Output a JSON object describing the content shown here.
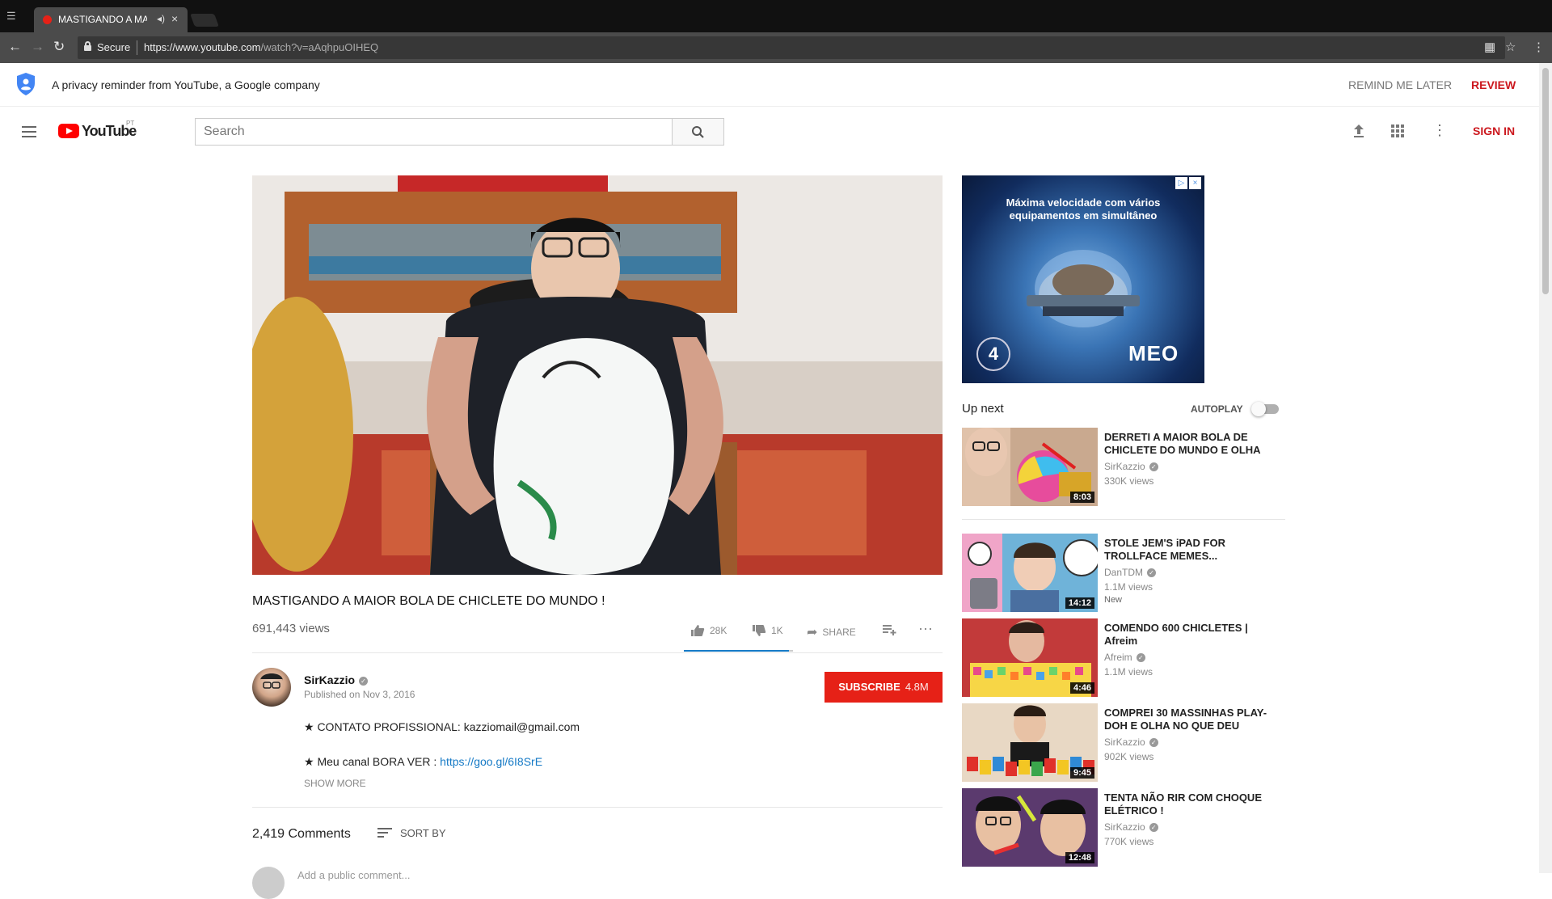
{
  "browser": {
    "tab_title": "MASTIGANDO A MAI",
    "secure_label": "Secure",
    "url_host": "https://www.youtube.com",
    "url_path": "/watch?v=aAqhpuOIHEQ"
  },
  "privacy": {
    "message": "A privacy reminder from YouTube, a Google company",
    "remind_label": "REMIND ME LATER",
    "review_label": "REVIEW"
  },
  "masthead": {
    "logo_text": "YouTube",
    "region": "PT",
    "search_placeholder": "Search",
    "signin_label": "SIGN IN"
  },
  "icons": {
    "menu": "hamburger-icon",
    "search": "search-icon",
    "upload": "upload-icon",
    "apps": "apps-grid-icon",
    "more": "more-vertical-icon"
  },
  "ad": {
    "headline": "Máxima velocidade com vários equipamentos em simultâneo",
    "brand": "MEO",
    "badge_number": "4"
  },
  "video": {
    "title": "MASTIGANDO A MAIOR BOLA DE CHICLETE DO MUNDO !",
    "views": "691,443 views",
    "likes": "28K",
    "dislikes": "1K",
    "share_label": "SHARE",
    "like_ratio": 0.966
  },
  "owner": {
    "name": "SirKazzio",
    "published": "Published on Nov 3, 2016",
    "subscribe_label": "SUBSCRIBE",
    "subscriber_count": "4.8M"
  },
  "description": {
    "line1": "★ CONTATO PROFISSIONAL: kazziomail@gmail.com",
    "line2_prefix": "★ Meu canal BORA VER : ",
    "line2_link": "https://goo.gl/6I8SrE",
    "show_more": "SHOW MORE"
  },
  "comments": {
    "count": "2,419 Comments",
    "sort_label": "SORT BY",
    "placeholder": "Add a public comment..."
  },
  "sidebar": {
    "up_next": "Up next",
    "autoplay_label": "AUTOPLAY",
    "autoplay_on": false,
    "items": [
      {
        "title": "DERRETI A MAIOR BOLA DE CHICLETE DO MUNDO E OLHA",
        "channel": "SirKazzio",
        "views": "330K views",
        "duration": "8:03",
        "badge": ""
      },
      {
        "title": "STOLE JEM'S iPAD FOR TROLLFACE MEMES...",
        "channel": "DanTDM",
        "views": "1.1M views",
        "duration": "14:12",
        "badge": "New"
      },
      {
        "title": "COMENDO 600 CHICLETES | Afreim",
        "channel": "Afreim",
        "views": "1.1M views",
        "duration": "4:46",
        "badge": ""
      },
      {
        "title": "COMPREI 30 MASSINHAS PLAY-DOH E OLHA NO QUE DEU",
        "channel": "SirKazzio",
        "views": "902K views",
        "duration": "9:45",
        "badge": ""
      },
      {
        "title": "TENTA NÃO RIR COM CHOQUE ELÉTRICO !",
        "channel": "SirKazzio",
        "views": "770K views",
        "duration": "12:48",
        "badge": ""
      }
    ]
  }
}
